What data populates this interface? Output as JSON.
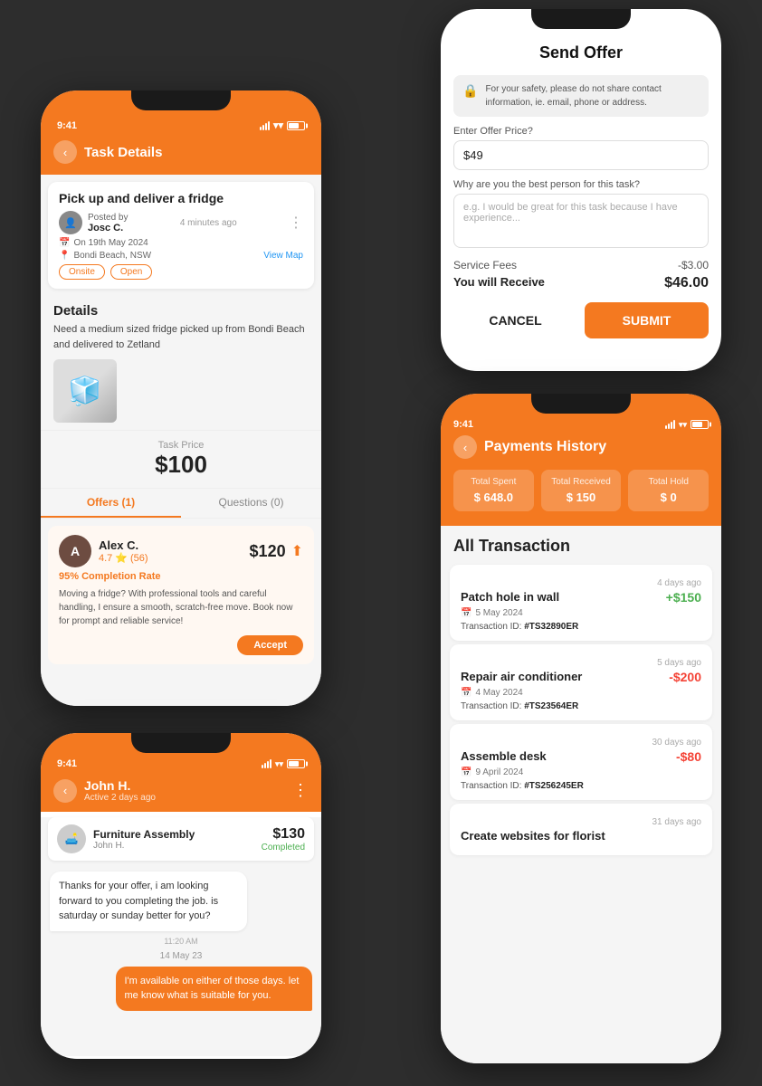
{
  "background": "#2d2d2d",
  "phone1": {
    "status_time": "9:41",
    "header_title": "Task Details",
    "task": {
      "title": "Pick up and deliver a fridge",
      "posted_by_label": "Posted by",
      "poster_name": "Josc C.",
      "time_ago": "4 minutes ago",
      "date": "On 19th May 2024",
      "location": "Bondi Beach, NSW",
      "view_map": "View Map",
      "tag1": "Onsite",
      "tag2": "Open"
    },
    "details_title": "Details",
    "details_text": "Need a medium sized fridge picked up from Bondi Beach and delivered to Zetland",
    "price_label": "Task Price",
    "price": "$100",
    "tab_offers": "Offers (1)",
    "tab_questions": "Questions (0)",
    "offer": {
      "name": "Alex C.",
      "rating": "4.7",
      "reviews": "(56)",
      "completion": "95%",
      "completion_label": "Completion Rate",
      "price": "$120",
      "description": "Moving a fridge? With professional tools and careful handling, I ensure a smooth, scratch-free move. Book now for prompt and reliable service!",
      "accept_label": "Accept"
    }
  },
  "phone2": {
    "title": "Send Offer",
    "safety_text": "For your safety, please do not share contact information, ie. email, phone or address.",
    "price_label": "Enter Offer Price?",
    "price_value": "$49",
    "desc_label": "Why are you the best person for this task?",
    "desc_placeholder": "e.g. I would be great for this task because I have experience...",
    "service_fees_label": "Service Fees",
    "service_fees_value": "-$3.00",
    "you_receive_label": "You will Receive",
    "you_receive_value": "$46.00",
    "cancel_label": "CANCEL",
    "submit_label": "SUBMIT"
  },
  "phone3": {
    "status_time": "9:41",
    "user_name": "John H.",
    "user_status": "Active 2 days ago",
    "task_title": "Furniture Assembly",
    "task_user": "John H.",
    "task_price": "$130",
    "task_status": "Completed",
    "message1": "Thanks for your offer, i am looking forward to you completing the job. is saturday or sunday better for you?",
    "message1_time": "11:20 AM",
    "date_divider": "14 May 23",
    "message2": "I'm available on either of those days. let me know what is suitable for you."
  },
  "phone4": {
    "status_time": "9:41",
    "title": "Payments History",
    "total_spent_label": "Total Spent",
    "total_spent_value": "$ 648.0",
    "total_received_label": "Total Received",
    "total_received_value": "$ 150",
    "total_hold_label": "Total Hold",
    "total_hold_value": "$ 0",
    "all_transactions_title": "All Transaction",
    "transactions": [
      {
        "title": "Patch hole in wall",
        "days_ago": "4 days ago",
        "date": "5 May 2024",
        "amount": "+$150",
        "amount_type": "positive",
        "txn_id": "#TS32890ER"
      },
      {
        "title": "Repair air conditioner",
        "days_ago": "5 days ago",
        "date": "4 May 2024",
        "amount": "-$200",
        "amount_type": "negative",
        "txn_id": "#TS23564ER"
      },
      {
        "title": "Assemble desk",
        "days_ago": "30 days ago",
        "date": "9 April 2024",
        "amount": "-$80",
        "amount_type": "negative",
        "txn_id": "#TS256245ER"
      },
      {
        "title": "Create websites for florist",
        "days_ago": "31 days ago",
        "date": "",
        "amount": "",
        "amount_type": "",
        "txn_id": ""
      }
    ]
  }
}
